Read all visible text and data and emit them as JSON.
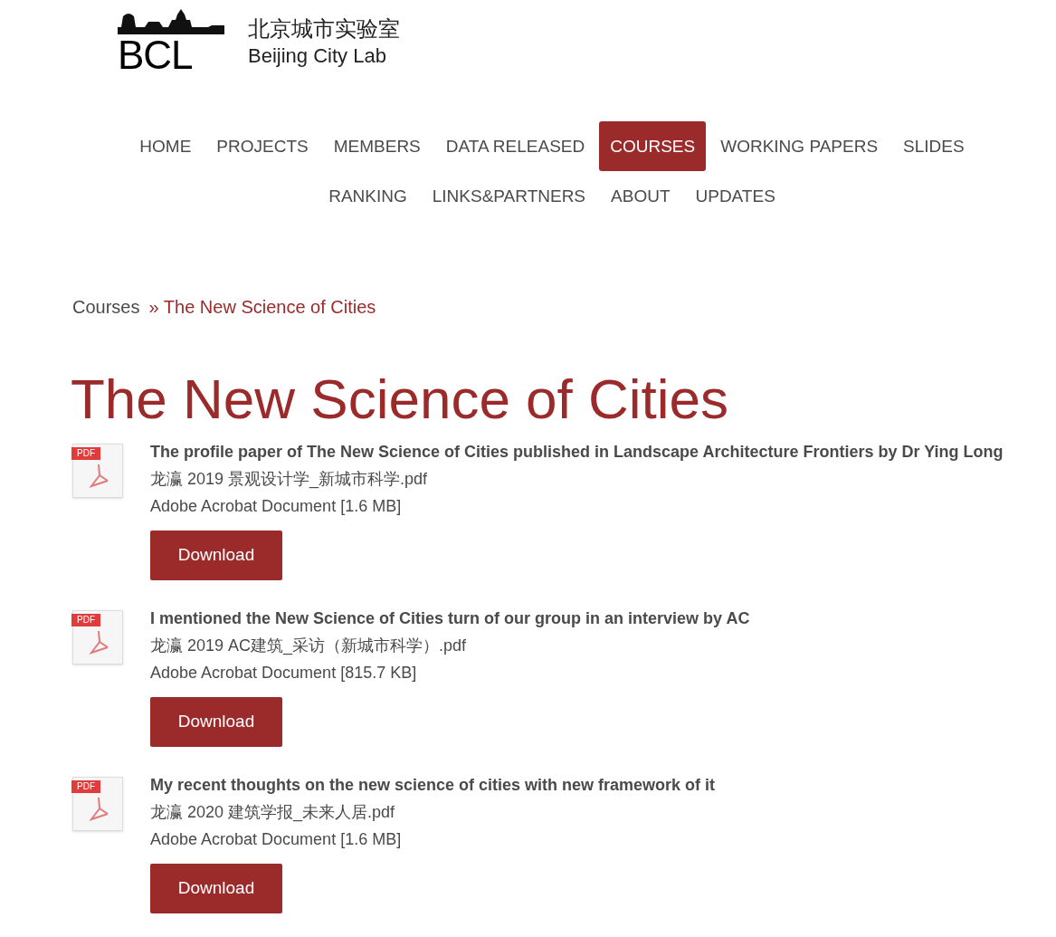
{
  "logo": {
    "mark": "BCL",
    "name_zh": "北京城市实验室",
    "name_en": "Beijing City Lab"
  },
  "nav": [
    {
      "label": "HOME",
      "selected": false
    },
    {
      "label": "PROJECTS",
      "selected": false
    },
    {
      "label": "MEMBERS",
      "selected": false
    },
    {
      "label": "DATA RELEASED",
      "selected": false
    },
    {
      "label": "COURSES",
      "selected": true
    },
    {
      "label": "WORKING PAPERS",
      "selected": false
    },
    {
      "label": "SLIDES",
      "selected": false
    },
    {
      "label": "RANKING",
      "selected": false
    },
    {
      "label": "LINKS&PARTNERS",
      "selected": false
    },
    {
      "label": "ABOUT",
      "selected": false
    },
    {
      "label": "UPDATES",
      "selected": false
    }
  ],
  "breadcrumb": [
    {
      "label": "Courses",
      "current": false
    },
    {
      "label": "» The New Science of Cities",
      "current": true
    }
  ],
  "title": "The New Science of Cities",
  "files": [
    {
      "badge": "PDF",
      "title": "The profile paper of The New Science of Cities published in Landscape Architecture Frontiers by Dr Ying Long",
      "filename": "龙瀛 2019 景观设计学_新城市科学.pdf",
      "meta": "Adobe Acrobat Document [1.6 MB]",
      "button": "Download"
    },
    {
      "badge": "PDF",
      "title": "I mentioned the New Science of Cities turn of our group in an interview by AC",
      "filename": "龙瀛 2019 AC建筑_采访（新城市科学）.pdf",
      "meta": "Adobe Acrobat Document [815.7 KB]",
      "button": "Download"
    },
    {
      "badge": "PDF",
      "title": "My recent thoughts on the new science of cities with new framework of it",
      "filename": "龙瀛 2020 建筑学报_未来人居.pdf",
      "meta": "Adobe Acrobat Document [1.6 MB]",
      "button": "Download"
    }
  ]
}
